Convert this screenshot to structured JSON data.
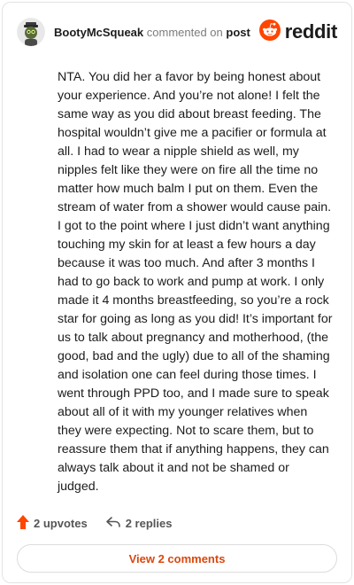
{
  "header": {
    "username": "BootyMcSqueak",
    "action_text": "commented on",
    "post_link": "post",
    "brand": "reddit"
  },
  "comment": {
    "body": "NTA. You did her a favor by being honest about your experience. And you’re not alone! I felt the same way as you did about breast feeding. The hospital wouldn’t give me a pacifier or formula at all. I had to wear a nipple shield as well, my nipples felt like they were on fire all the time no matter how much balm I put on them. Even the stream of water from a shower would cause pain. I got to the point where I just didn’t want anything touching my skin for at least a few hours a day because it was too much. And after 3 months I had to go back to work and pump at work. I only made it 4 months breastfeeding, so you’re a rock star for going as long as you did! It’s important for us to talk about pregnancy and motherhood, (the good, bad and the ugly) due to all of the shaming and isolation one can feel during those times. I went through PPD too, and I made sure to speak about all of it with my younger relatives when they were expecting. Not to scare them, but to reassure them that if anything happens, they can always talk about it and not be shamed or judged."
  },
  "actions": {
    "upvotes": "2 upvotes",
    "replies": "2 replies"
  },
  "footer": {
    "view_comments": "View 2 comments"
  },
  "colors": {
    "accent": "#ff4500",
    "link": "#d9480f",
    "muted": "#7c7c7c"
  },
  "icons": [
    "avatar",
    "reddit-logo-icon",
    "upvote-arrow-icon",
    "reply-icon"
  ]
}
